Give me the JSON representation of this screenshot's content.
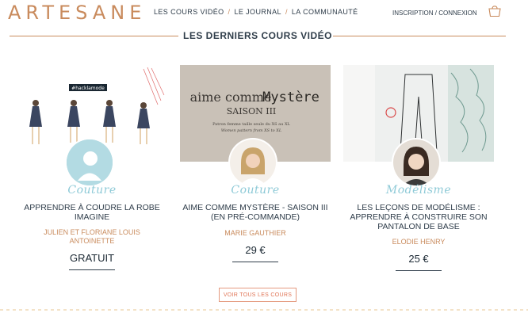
{
  "header": {
    "logo": "ARTESANE",
    "nav": [
      "LES COURS VIDÉO",
      "LE JOURNAL",
      "LA COMMUNAUTÉ"
    ],
    "nav_sep": "/",
    "login": "INSCRIPTION / CONNEXION",
    "cart_icon": "shopping-bag-icon"
  },
  "section": {
    "title": "LES DERNIERS COURS VIDÉO"
  },
  "cards": [
    {
      "category": "Couture",
      "title_lines": [
        "APPRENDRE À COUDRE LA ROBE",
        "IMAGINE"
      ],
      "author_lines": [
        "JULIEN ET FLORIANE LOUIS",
        "ANTOINETTE"
      ],
      "price": "GRATUIT",
      "thumb_text": "#hacklamode"
    },
    {
      "category": "Couture",
      "title_lines": [
        "AIME COMME MYSTÈRE - SAISON III",
        "(EN PRÉ-COMMANDE)"
      ],
      "author_lines": [
        "MARIE GAUTHIER"
      ],
      "price": "29 €",
      "thumb_line1": "aime comme",
      "thumb_line1b": "Mystère",
      "thumb_line2": "SAISON III",
      "thumb_small1": "Patron femme taille seule du XS au XL",
      "thumb_small2": "Women pattern from XS to XL"
    },
    {
      "category": "Modélisme",
      "title_lines": [
        "LES LEÇONS DE MODÉLISME :",
        "APPRENDRE À CONSTRUIRE SON",
        "PANTALON DE BASE"
      ],
      "author_lines": [
        "ELODIE HENRY"
      ],
      "price": "25 €"
    }
  ],
  "all_courses_button": "VOIR TOUS LES COURS",
  "colors": {
    "accent": "#c98b5d",
    "category": "#8ecad7",
    "text": "#2f3d4a",
    "button": "#e07556"
  }
}
